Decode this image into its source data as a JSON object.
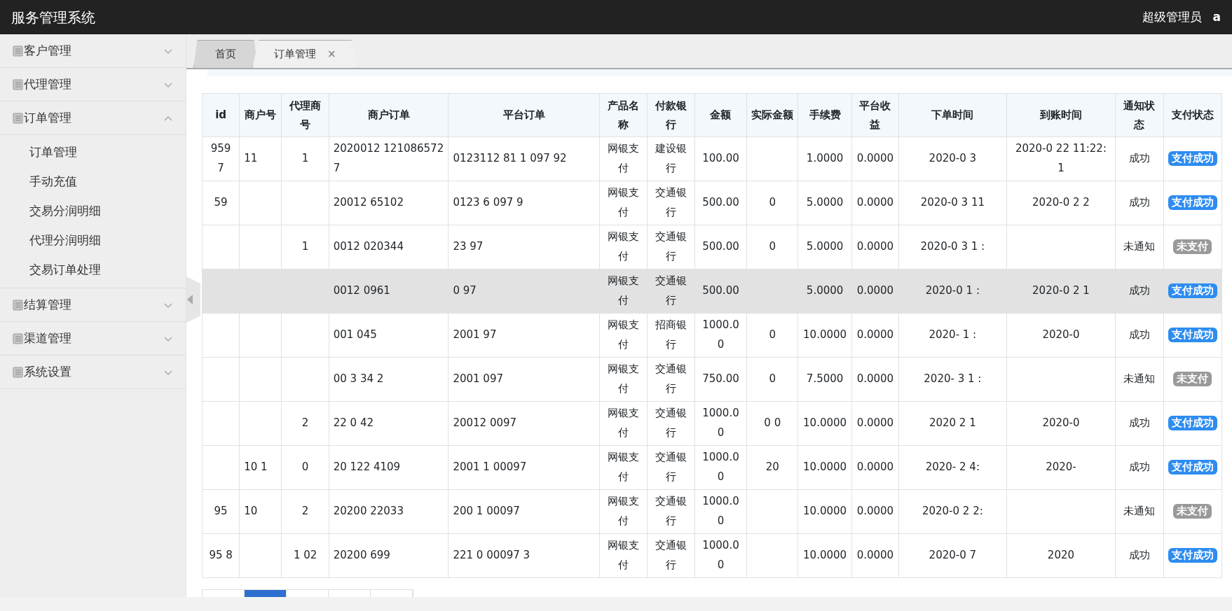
{
  "header": {
    "title": "服务管理系统",
    "user_role": "超级管理员",
    "user_name": "a"
  },
  "sidebar": {
    "items": [
      {
        "label": "客户管理",
        "expanded": false
      },
      {
        "label": "代理管理",
        "expanded": false
      },
      {
        "label": "订单管理",
        "expanded": true,
        "children": [
          {
            "label": "订单管理"
          },
          {
            "label": "手动充值"
          },
          {
            "label": "交易分润明细"
          },
          {
            "label": "代理分润明细"
          },
          {
            "label": "交易订单处理"
          }
        ]
      },
      {
        "label": "结算管理",
        "expanded": false
      },
      {
        "label": "渠道管理",
        "expanded": false
      },
      {
        "label": "系统设置",
        "expanded": false
      }
    ]
  },
  "tabs": [
    {
      "label": "首页",
      "selected": false,
      "closable": false
    },
    {
      "label": "订单管理",
      "selected": true,
      "closable": true,
      "close": "×"
    }
  ],
  "table": {
    "columns": [
      "id",
      "商户号",
      "代理商号",
      "商户订单",
      "平台订单",
      "产品名称",
      "付款银行",
      "金额",
      "实际金额",
      "手续费",
      "平台收益",
      "下单时间",
      "到账时间",
      "通知状态",
      "支付状态"
    ],
    "rows": [
      {
        "hovered": false,
        "paid": true,
        "cells": [
          "959 7",
          "11",
          "1",
          "2020012 121086572 7",
          "0123112 81 1 097 92",
          "网银支付",
          "建设银行",
          "100.00",
          null,
          "1.0000",
          "0.0000",
          "2020-0 3",
          "2020-0 22 11:22: 1",
          "成功",
          "支付成功"
        ]
      },
      {
        "hovered": false,
        "paid": true,
        "cells": [
          "59",
          null,
          null,
          "20012 65102",
          "0123 6 097 9",
          "网银支付",
          "交通银行",
          "500.00",
          "0",
          "5.0000",
          "0.0000",
          "2020-0 3 11",
          "2020-0 2 2",
          "成功",
          "支付成功"
        ]
      },
      {
        "hovered": false,
        "paid": false,
        "cells": [
          null,
          null,
          "1",
          "0012 020344",
          "23 97",
          "网银支付",
          "交通银行",
          "500.00",
          "0",
          "5.0000",
          "0.0000",
          "2020-0 3 1 :",
          null,
          "未通知",
          "未支付"
        ]
      },
      {
        "hovered": true,
        "paid": true,
        "cells": [
          null,
          null,
          null,
          "0012 0961",
          "0 97",
          "网银支付",
          "交通银行",
          "500.00",
          null,
          "5.0000",
          "0.0000",
          "2020-0 1 :",
          "2020-0 2 1",
          "成功",
          "支付成功"
        ]
      },
      {
        "hovered": false,
        "paid": true,
        "cells": [
          null,
          null,
          null,
          "001 045",
          "2001 97",
          "网银支付",
          "招商银行",
          "1000.00",
          "0",
          "10.0000",
          "0.0000",
          "2020- 1 :",
          "2020-0",
          "成功",
          "支付成功"
        ]
      },
      {
        "hovered": false,
        "paid": false,
        "cells": [
          null,
          null,
          null,
          "00 3 34 2",
          "2001 097",
          "网银支付",
          "交通银行",
          "750.00",
          "0",
          "7.5000",
          "0.0000",
          "2020- 3 1 :",
          null,
          "未通知",
          "未支付"
        ]
      },
      {
        "hovered": false,
        "paid": true,
        "cells": [
          null,
          null,
          "2",
          "22 0 42",
          "20012 0097",
          "网银支付",
          "交通银行",
          "1000.00",
          "0 0",
          "10.0000",
          "0.0000",
          "2020 2 1",
          "2020-0",
          "成功",
          "支付成功"
        ]
      },
      {
        "hovered": false,
        "paid": true,
        "cells": [
          null,
          "10 1",
          "0",
          "20 122 4109",
          "2001 1 00097",
          "网银支付",
          "交通银行",
          "1000.00",
          "20",
          "10.0000",
          "0.0000",
          "2020- 2 4:",
          "2020-",
          "成功",
          "支付成功"
        ]
      },
      {
        "hovered": false,
        "paid": false,
        "cells": [
          "95",
          "10",
          "2",
          "20200 22033",
          "200 1 00097",
          "网银支付",
          "交通银行",
          "1000.00",
          null,
          "10.0000",
          "0.0000",
          "2020-0 2 2:",
          null,
          "未通知",
          "未支付"
        ]
      },
      {
        "hovered": false,
        "paid": true,
        "cells": [
          "95 8",
          null,
          "1 02",
          "20200 699",
          "221 0 00097 3",
          "网银支付",
          "交通银行",
          "1000.00",
          null,
          "10.0000",
          "0.0000",
          "2020-0 7",
          "2020",
          "成功",
          "支付成功"
        ]
      }
    ]
  },
  "pagination": {
    "pages": [
      {
        "selected": false
      },
      {
        "selected": true
      },
      {
        "selected": false
      },
      {
        "selected": false
      },
      {
        "selected": false
      }
    ]
  }
}
